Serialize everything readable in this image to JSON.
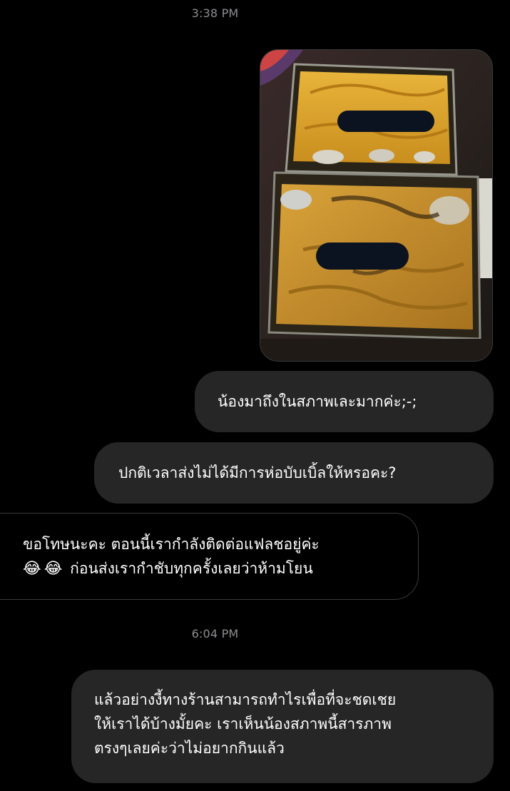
{
  "conversation": {
    "timestamps": [
      "3:38 PM",
      "6:04 PM"
    ],
    "messages": [
      {
        "direction": "outgoing",
        "lines": [
          "น้องมาถึงในสภาพเละมากค่ะ;-;"
        ]
      },
      {
        "direction": "outgoing",
        "lines": [
          "ปกติเวลาส่งไม่ได้มีการห่อบับเบิ้ลให้หรอคะ?"
        ]
      },
      {
        "direction": "incoming",
        "lines": [
          "ขอโทษนะคะ ตอนนี้เรากำลังติดต่อแฟลชอยู่ค่ะ",
          "ก่อนส่งเรากำชับทุกครั้งเลยว่าห้ามโยน"
        ],
        "emojis": [
          "😂",
          "😂"
        ]
      },
      {
        "direction": "outgoing",
        "lines": [
          "แล้วอย่างงี้ทางร้านสามารถทำไรเพื่อที่จะชดเชย",
          "ให้เราได้บ้างมั้ยคะ เราเห็นน้องสภาพนี้สารภาพ",
          "ตรงๆเลยค่ะว่าไม่อยากกินแล้ว"
        ]
      }
    ]
  },
  "colors": {
    "background": "#000000",
    "outgoing_bubble": "#262626",
    "incoming_border": "#3a3a3c",
    "timestamp": "#8e8e93",
    "text": "#ffffff"
  }
}
